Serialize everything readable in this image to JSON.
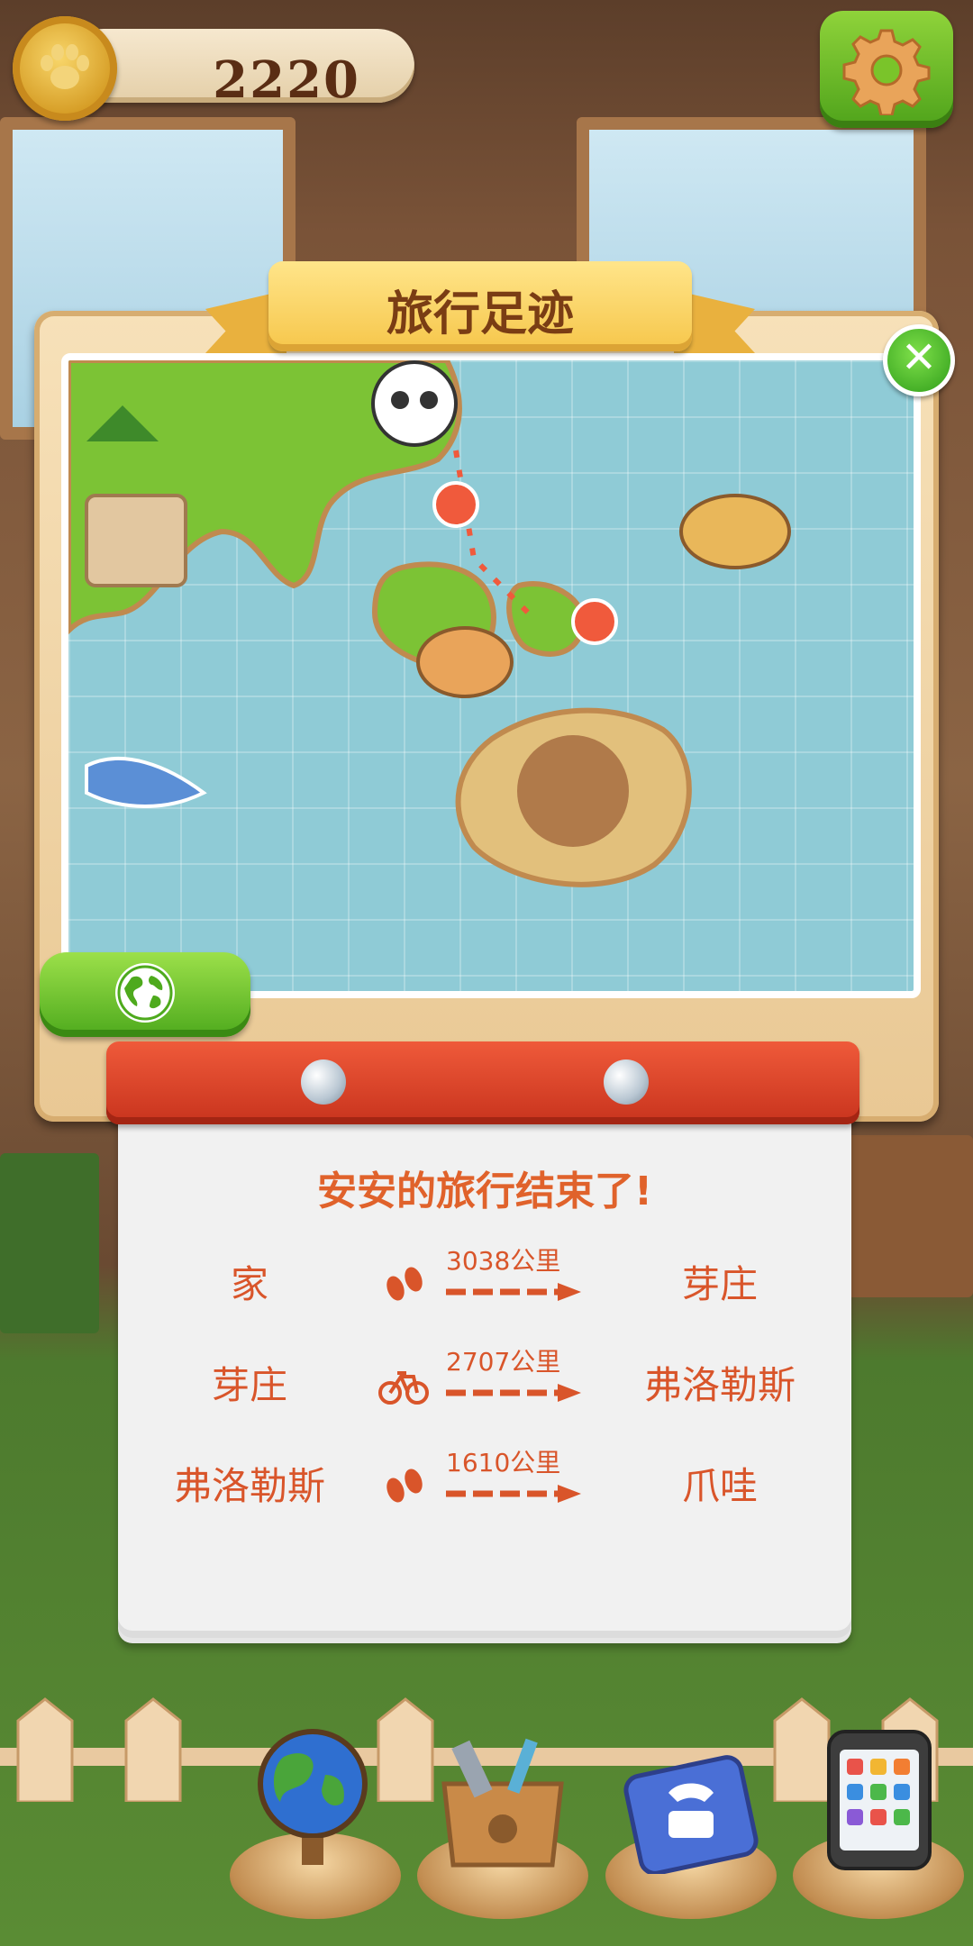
{
  "header": {
    "coins": "2220"
  },
  "panel": {
    "title": "旅行足迹"
  },
  "summary": {
    "title": "安安的旅行结束了!",
    "legs": [
      {
        "from": "家",
        "mode": "walk",
        "distance": "3038公里",
        "to": "芽庄"
      },
      {
        "from": "芽庄",
        "mode": "bike",
        "distance": "2707公里",
        "to": "弗洛勒斯"
      },
      {
        "from": "弗洛勒斯",
        "mode": "walk",
        "distance": "1610公里",
        "to": "爪哇"
      }
    ]
  },
  "icons": {
    "coin": "paw-coin-icon",
    "settings": "gear-icon",
    "close": "close-icon",
    "globe": "globe-icon",
    "walk": "footprints-icon",
    "bike": "bicycle-icon",
    "dock": [
      "globe-dock-icon",
      "toolbox-dock-icon",
      "phone-book-dock-icon",
      "mobile-phone-dock-icon"
    ]
  },
  "colors": {
    "accent": "#d9552a",
    "title": "#e0622b",
    "ribbon": "#f6c64a",
    "button_green": "#4fa31b",
    "note_bar": "#c8331d"
  }
}
